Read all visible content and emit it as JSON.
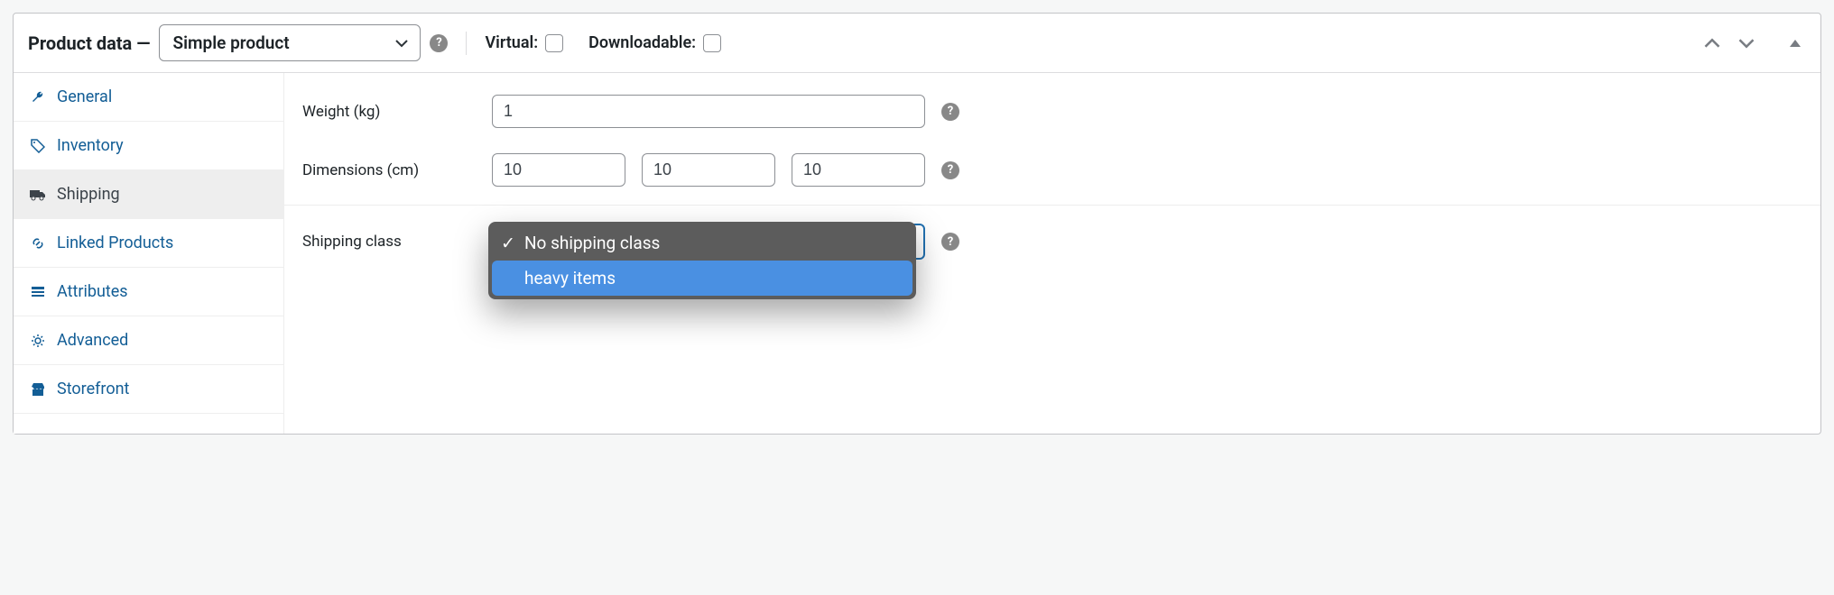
{
  "header": {
    "title": "Product data —",
    "product_type": "Simple product",
    "virtual_label": "Virtual:",
    "downloadable_label": "Downloadable:"
  },
  "sidebar": {
    "items": [
      {
        "label": "General",
        "icon": "wrench-icon",
        "active": false
      },
      {
        "label": "Inventory",
        "icon": "tag-icon",
        "active": false
      },
      {
        "label": "Shipping",
        "icon": "truck-icon",
        "active": true
      },
      {
        "label": "Linked Products",
        "icon": "link-icon",
        "active": false
      },
      {
        "label": "Attributes",
        "icon": "list-icon",
        "active": false
      },
      {
        "label": "Advanced",
        "icon": "gear-icon",
        "active": false
      },
      {
        "label": "Storefront",
        "icon": "store-icon",
        "active": false
      }
    ]
  },
  "shipping": {
    "weight_label": "Weight (kg)",
    "weight_value": "1",
    "dimensions_label": "Dimensions (cm)",
    "length": "10",
    "width": "10",
    "height": "10",
    "class_label": "Shipping class",
    "class_options": [
      {
        "label": "No shipping class",
        "selected": true,
        "highlighted": false
      },
      {
        "label": "heavy items",
        "selected": false,
        "highlighted": true
      }
    ]
  },
  "glyphs": {
    "help": "?",
    "check": "✓"
  }
}
